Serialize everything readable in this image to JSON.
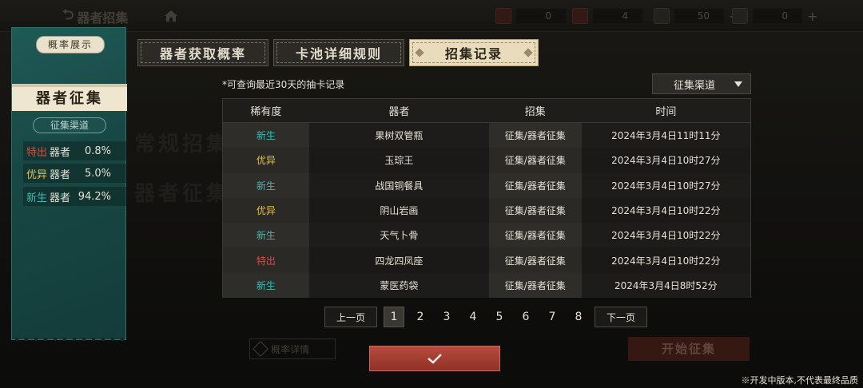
{
  "colors": {
    "rarity_teshu": "#e14a3c",
    "rarity_youyi": "#e6c24a",
    "rarity_xinsheng": "#3fb9b1",
    "accent_red": "#b84a3c"
  },
  "topbar": {
    "title": "器者招集",
    "currencies": [
      {
        "icon": "red-ticket-icon",
        "value": "0"
      },
      {
        "icon": "lantern-icon",
        "value": "4"
      },
      {
        "icon": "scroll-icon",
        "value": "50"
      },
      {
        "icon": "dice-icon",
        "value": "0"
      }
    ]
  },
  "background": {
    "ghost_1": "常规招集",
    "ghost_2": "器者征集",
    "prob_detail": "概率详情",
    "start_recruit": "开始征集"
  },
  "left_panel": {
    "tag": "概率展示",
    "title": "器者征集",
    "channel": "征集渠道",
    "rows": [
      {
        "rarity": "特出",
        "label": "器者",
        "percent": "0.8%",
        "color": "#e14a3c"
      },
      {
        "rarity": "优异",
        "label": "器者",
        "percent": "5.0%",
        "color": "#e6c24a"
      },
      {
        "rarity": "新生",
        "label": "器者",
        "percent": "94.2%",
        "color": "#3fb9b1"
      }
    ]
  },
  "tabs": [
    {
      "label": "器者获取概率",
      "active": false
    },
    {
      "label": "卡池详细规则",
      "active": false
    },
    {
      "label": "招集记录",
      "active": true
    }
  ],
  "note": "*可查询最近30天的抽卡记录",
  "dropdown": {
    "selected": "征集渠道"
  },
  "table": {
    "headers": [
      "稀有度",
      "器者",
      "招集",
      "时间"
    ],
    "rows": [
      {
        "rarity": "新生",
        "rarity_color": "#3fb9b1",
        "item": "果树双管瓶",
        "source": "征集/器者征集",
        "time": "2024年3月4日11时11分"
      },
      {
        "rarity": "优异",
        "rarity_color": "#e6c24a",
        "item": "玉琮王",
        "source": "征集/器者征集",
        "time": "2024年3月4日10时27分"
      },
      {
        "rarity": "新生",
        "rarity_color": "#3fb9b1",
        "item": "战国铜餐具",
        "source": "征集/器者征集",
        "time": "2024年3月4日10时27分"
      },
      {
        "rarity": "优异",
        "rarity_color": "#e6c24a",
        "item": "阴山岩画",
        "source": "征集/器者征集",
        "time": "2024年3月4日10时22分"
      },
      {
        "rarity": "新生",
        "rarity_color": "#3fb9b1",
        "item": "天气卜骨",
        "source": "征集/器者征集",
        "time": "2024年3月4日10时22分"
      },
      {
        "rarity": "特出",
        "rarity_color": "#e14a3c",
        "item": "四龙四凤座",
        "source": "征集/器者征集",
        "time": "2024年3月4日10时22分"
      },
      {
        "rarity": "新生",
        "rarity_color": "#3fb9b1",
        "item": "蒙医药袋",
        "source": "征集/器者征集",
        "time": "2024年3月4日8时52分"
      }
    ]
  },
  "pager": {
    "prev": "上一页",
    "next": "下一页",
    "pages": [
      "1",
      "2",
      "3",
      "4",
      "5",
      "6",
      "7",
      "8"
    ],
    "current": "1"
  },
  "confirm_icon": "check-icon",
  "footer_note": "※开发中版本,不代表最终品质"
}
